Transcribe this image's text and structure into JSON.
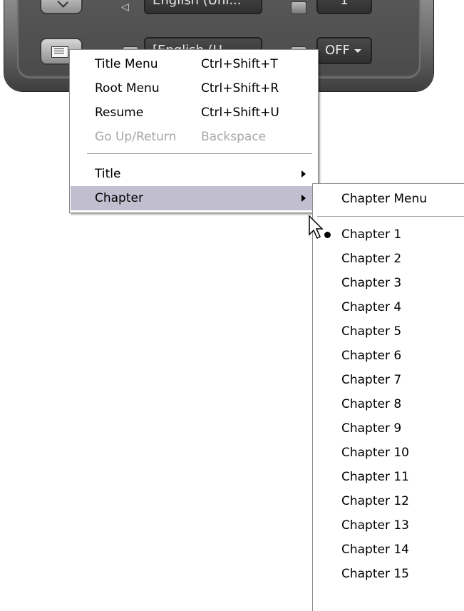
{
  "player": {
    "audio_dropdown": "English (Uni...",
    "subtitle_dropdown": "[English (U...",
    "subtitle_toggle": "OFF",
    "top_right_dropdown": "1",
    "icons": [
      "menu-button-icon",
      "speaker-icon",
      "subtitle-icon"
    ]
  },
  "context_menu": {
    "items": [
      {
        "label": "Title Menu",
        "shortcut": "Ctrl+Shift+T",
        "enabled": true
      },
      {
        "label": "Root Menu",
        "shortcut": "Ctrl+Shift+R",
        "enabled": true
      },
      {
        "label": "Resume",
        "shortcut": "Ctrl+Shift+U",
        "enabled": true
      },
      {
        "label": "Go Up/Return",
        "shortcut": "Backspace",
        "enabled": false
      }
    ],
    "submenus": [
      {
        "label": "Title",
        "has_submenu": true,
        "highlighted": false
      },
      {
        "label": "Chapter",
        "has_submenu": true,
        "highlighted": true
      }
    ]
  },
  "chapter_submenu": {
    "menu_item": "Chapter Menu",
    "selected_index": 0,
    "chapters": [
      "Chapter 1",
      "Chapter 2",
      "Chapter 3",
      "Chapter 4",
      "Chapter 5",
      "Chapter 6",
      "Chapter 7",
      "Chapter 8",
      "Chapter 9",
      "Chapter 10",
      "Chapter 11",
      "Chapter 12",
      "Chapter 13",
      "Chapter 14",
      "Chapter 15"
    ]
  },
  "colors": {
    "highlight": "#c1bfcf",
    "disabled_text": "#a7a6aa",
    "panel_dark": "#4a4a4a"
  }
}
